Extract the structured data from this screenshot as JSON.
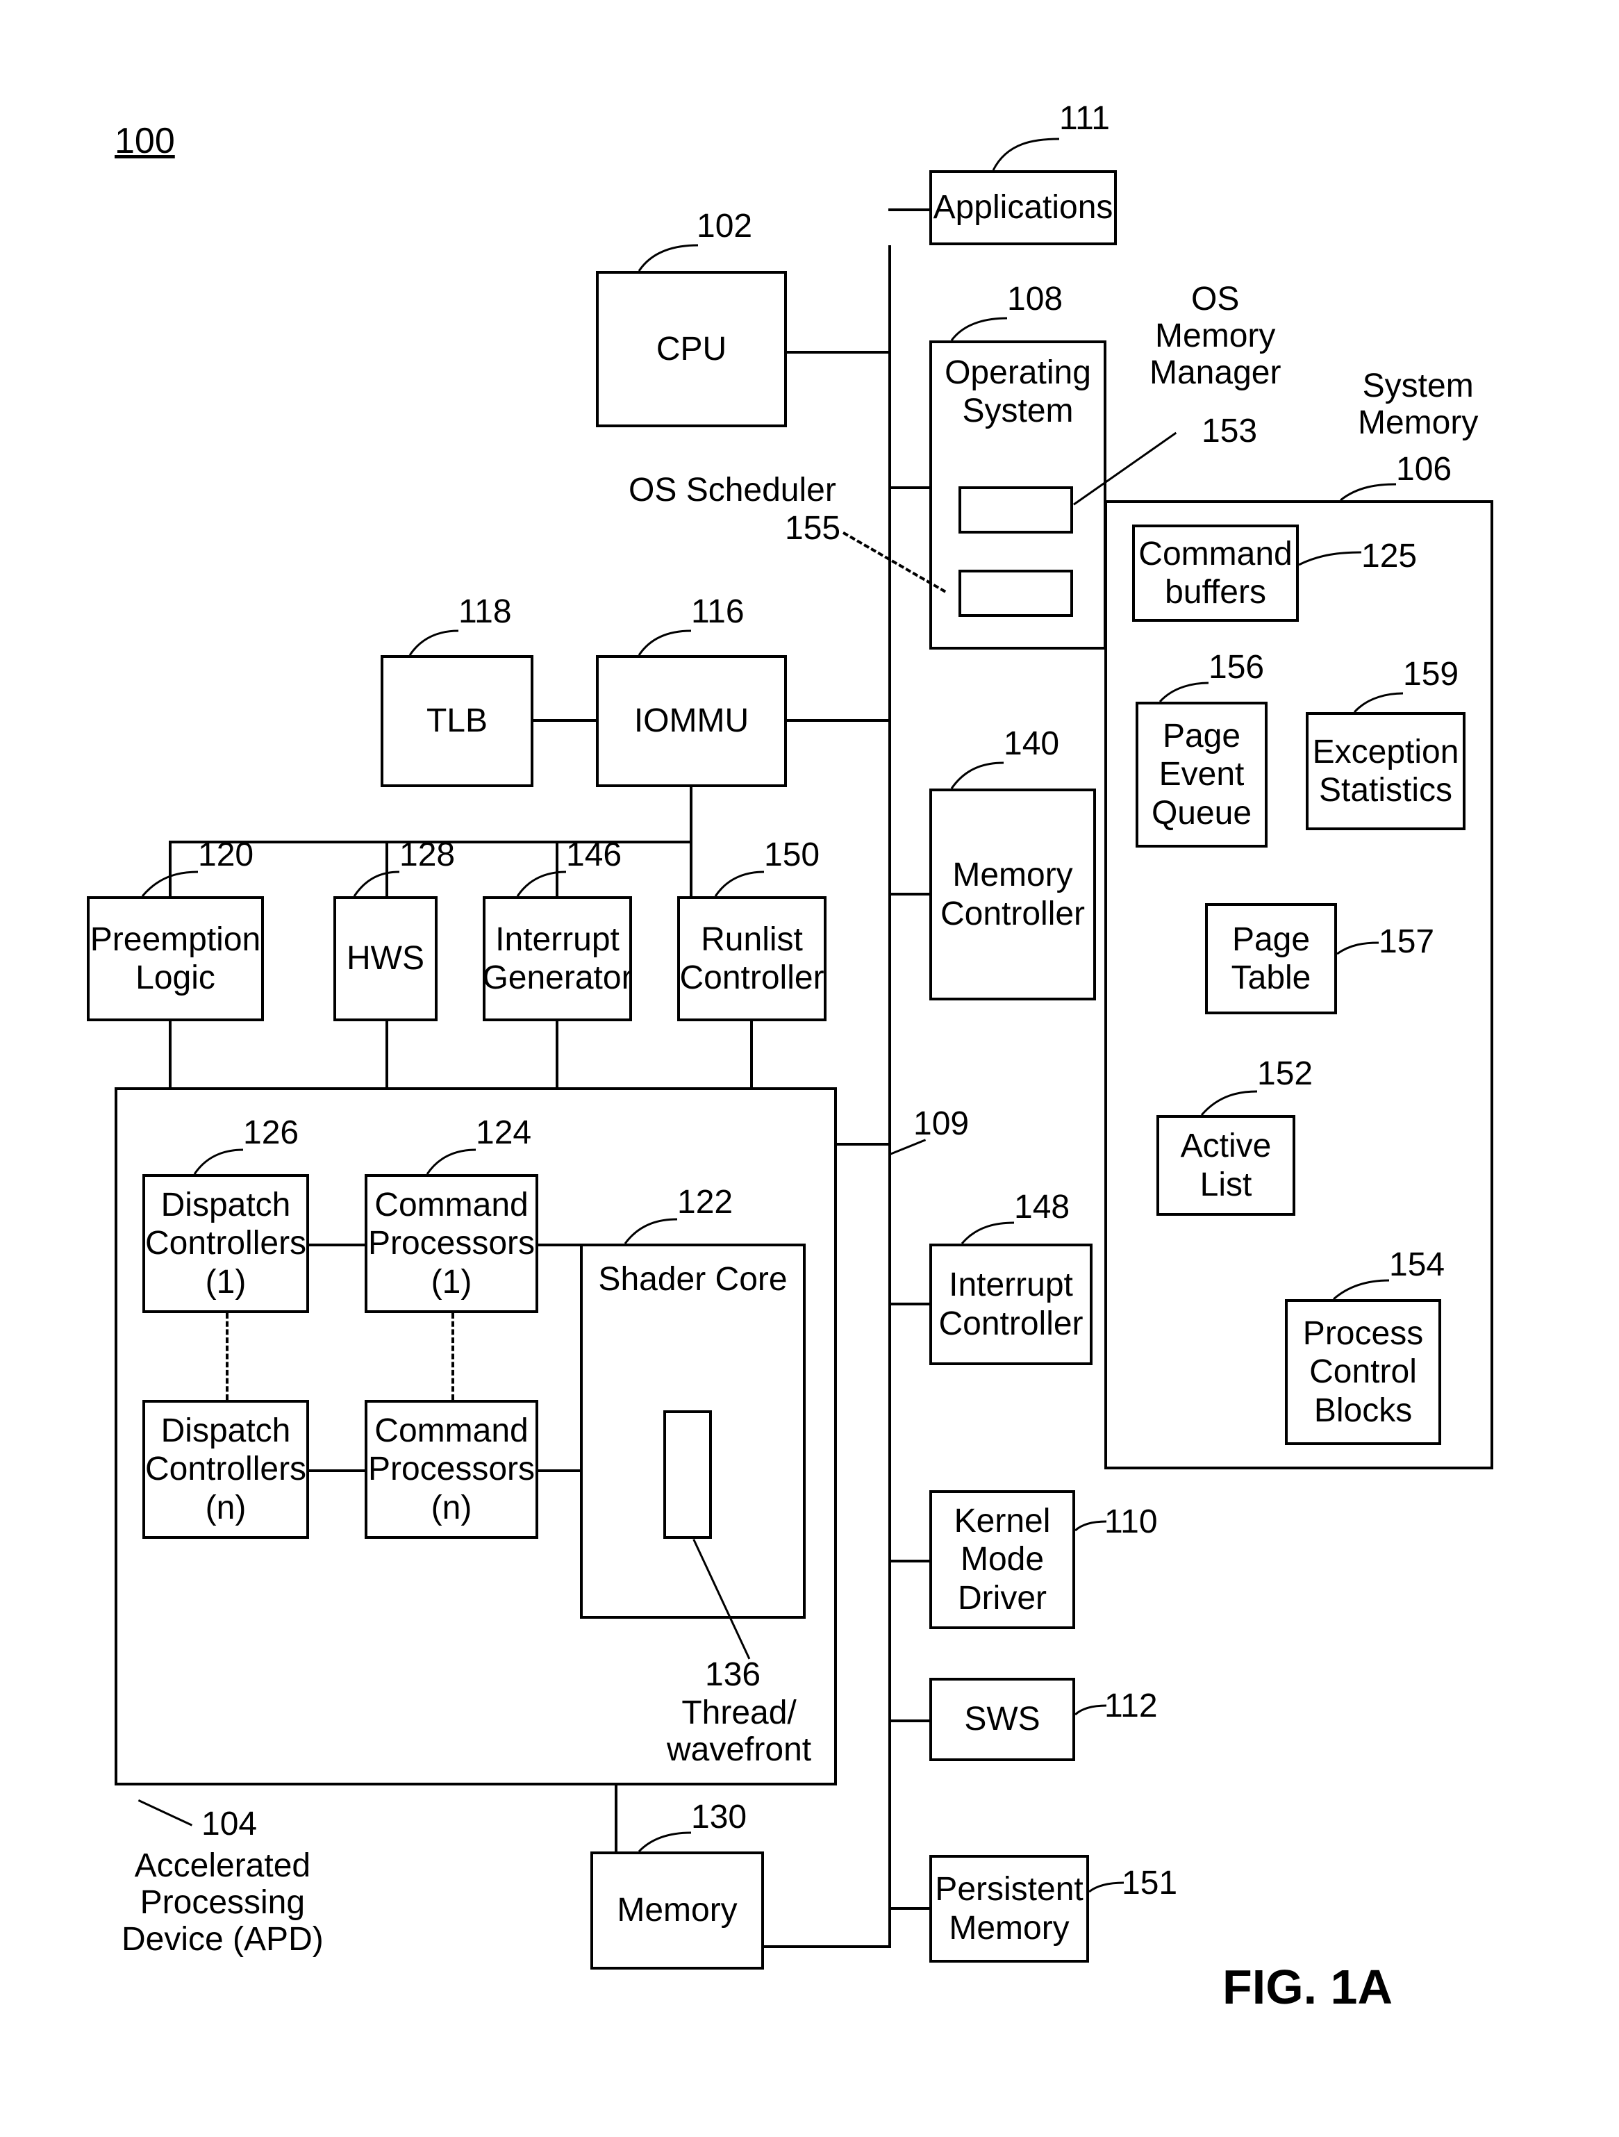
{
  "figure_ref": "100",
  "figure_label": "FIG. 1A",
  "cpu": {
    "num": "102",
    "label": "CPU"
  },
  "applications": {
    "num": "111",
    "label": "Applications"
  },
  "os": {
    "num": "108",
    "label": "Operating\nSystem",
    "ext_label": "OS\nMemory\nManager"
  },
  "os_mm": {
    "num": "153"
  },
  "os_sched": {
    "num": "155",
    "label": "OS Scheduler"
  },
  "sys_memory_title": "System\nMemory",
  "sys_memory_num": "106",
  "cmd_buffers": {
    "num": "125",
    "label": "Command\nbuffers"
  },
  "page_event_queue": {
    "num": "156",
    "label": "Page\nEvent\nQueue"
  },
  "exception_stats": {
    "num": "159",
    "label": "Exception\nStatistics"
  },
  "page_table": {
    "num": "157",
    "label": "Page\nTable"
  },
  "active_list": {
    "num": "152",
    "label": "Active\nList"
  },
  "pcb": {
    "num": "154",
    "label": "Process\nControl\nBlocks"
  },
  "tlb": {
    "num": "118",
    "label": "TLB"
  },
  "iommu": {
    "num": "116",
    "label": "IOMMU"
  },
  "mem_controller": {
    "num": "140",
    "label": "Memory\nController"
  },
  "interrupt_ctrl": {
    "num": "148",
    "label": "Interrupt\nController"
  },
  "kmd": {
    "num": "110",
    "label": "Kernel\nMode\nDriver"
  },
  "sws": {
    "num": "112",
    "label": "SWS"
  },
  "persist_mem": {
    "num": "151",
    "label": "Persistent\nMemory"
  },
  "memory": {
    "num": "130",
    "label": "Memory"
  },
  "preemption": {
    "num": "120",
    "label": "Preemption\nLogic"
  },
  "hws": {
    "num": "128",
    "label": "HWS"
  },
  "int_gen": {
    "num": "146",
    "label": "Interrupt\nGenerator"
  },
  "runlist": {
    "num": "150",
    "label": "Runlist\nController"
  },
  "apd_num": "104",
  "apd_label": "Accelerated\nProcessing\nDevice (APD)",
  "dc1": {
    "num": "126",
    "label": "Dispatch\nControllers\n(1)"
  },
  "dcn": {
    "label": "Dispatch\nControllers\n(n)"
  },
  "cp1": {
    "num": "124",
    "label": "Command\nProcessors\n(1)"
  },
  "cpn": {
    "label": "Command\nProcessors\n(n)"
  },
  "shader_core": {
    "num": "122",
    "label": "Shader Core"
  },
  "thread_wf": {
    "num": "136",
    "label": "Thread/\nwavefront"
  },
  "bus_num": "109"
}
